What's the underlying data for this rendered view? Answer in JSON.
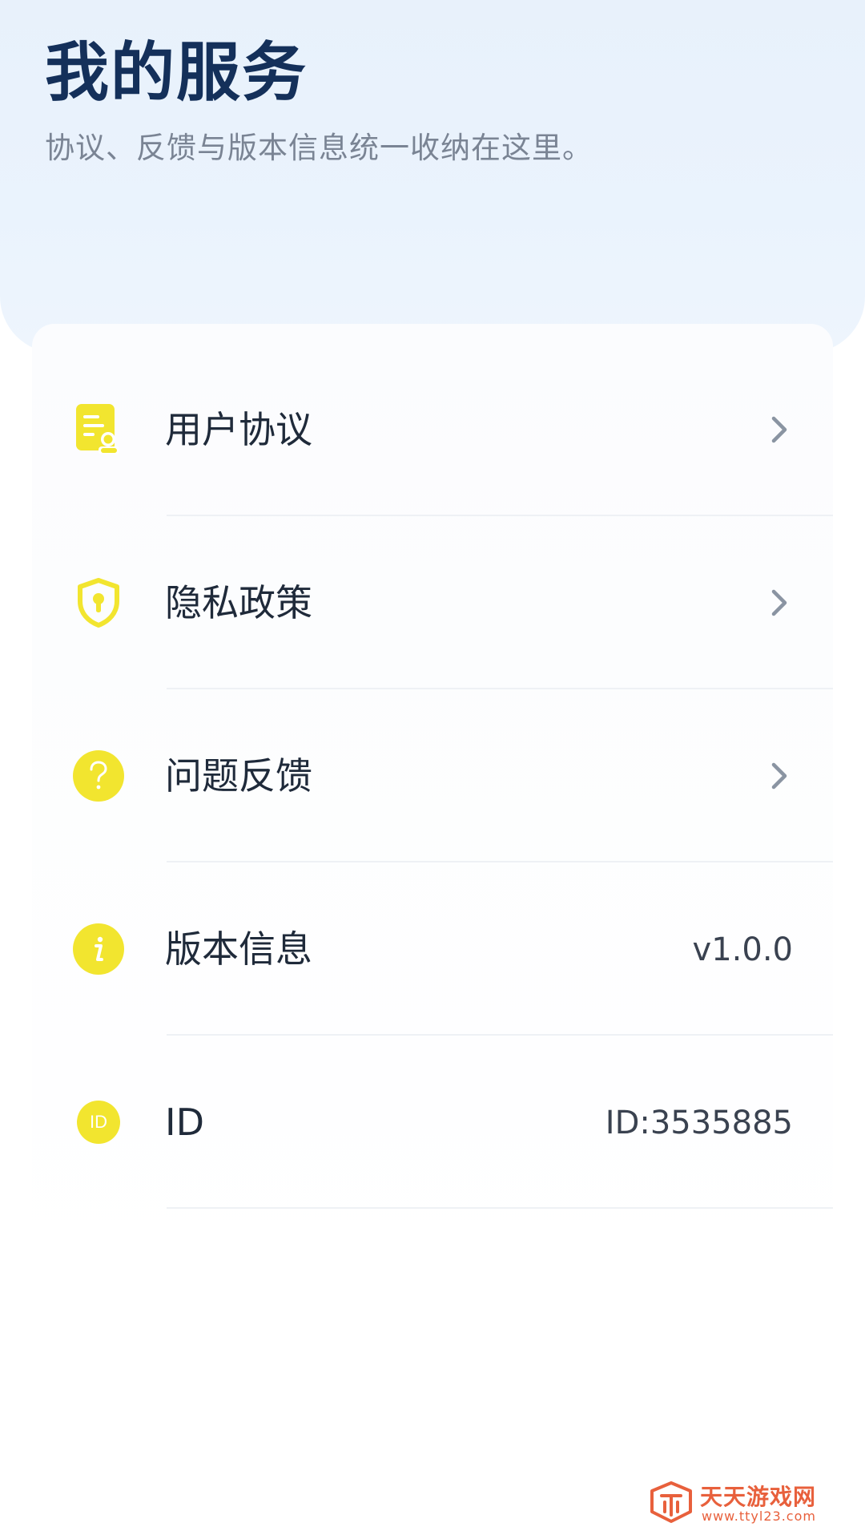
{
  "header": {
    "title": "我的服务",
    "subtitle": "协议、反馈与版本信息统一收纳在这里。"
  },
  "menu": {
    "items": [
      {
        "label": "用户协议",
        "icon": "document-user-icon",
        "action": "chevron"
      },
      {
        "label": "隐私政策",
        "icon": "shield-keyhole-icon",
        "action": "chevron"
      },
      {
        "label": "问题反馈",
        "icon": "question-circle-icon",
        "action": "chevron"
      },
      {
        "label": "版本信息",
        "icon": "info-circle-icon",
        "value": "v1.0.0"
      },
      {
        "label": "ID",
        "icon": "id-badge-icon",
        "icon_text": "ID",
        "value": "ID:3535885"
      }
    ]
  },
  "watermark": {
    "text": "天天游戏网",
    "url": "www.ttyl23.com"
  },
  "colors": {
    "title": "#14305a",
    "subtitle": "#7a8494",
    "icon_yellow": "#f2e52f",
    "chevron": "#8a94a2",
    "watermark": "#e8603c"
  }
}
